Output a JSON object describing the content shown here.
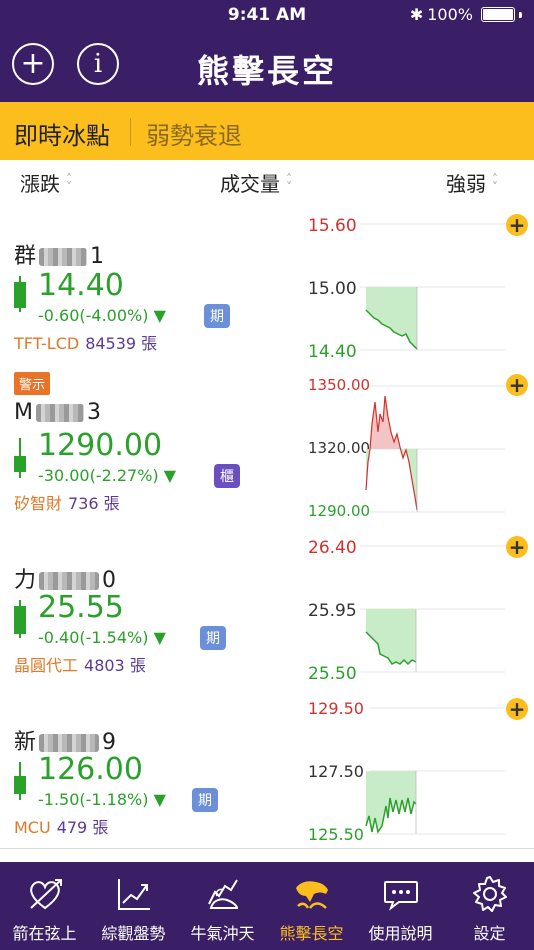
{
  "status": {
    "time": "9:41 AM",
    "battery": "100%",
    "bluetooth_icon": "bluetooth-icon"
  },
  "nav": {
    "title": "熊擊長空",
    "add_icon": "plus-circle-icon",
    "info_icon": "info-circle-icon",
    "add_symbol": "+",
    "info_symbol": "i"
  },
  "tabs": {
    "active": "即時冰點",
    "inactive": "弱勢衰退"
  },
  "columns": {
    "change": "漲跌",
    "volume": "成交量",
    "strength": "強弱"
  },
  "stocks": [
    {
      "name_prefix": "群",
      "name_suffix": "1",
      "price": "14.40",
      "change": "-0.60(-4.00%) ▼",
      "badge": "期",
      "industry": "TFT-LCD",
      "volume": "84539 張",
      "chart": {
        "high": "15.60",
        "mid": "15.00",
        "low": "14.40"
      }
    },
    {
      "warning": "警示",
      "name_prefix": "M",
      "name_suffix": "3",
      "price": "1290.00",
      "change": "-30.00(-2.27%) ▼",
      "badge": "櫃",
      "industry": "矽智財",
      "volume": "736 張",
      "chart": {
        "high": "1350.00",
        "mid": "1320.00",
        "low": "1290.00"
      }
    },
    {
      "name_prefix": "力",
      "name_suffix": "0",
      "price": "25.55",
      "change": "-0.40(-1.54%) ▼",
      "badge": "期",
      "industry": "晶圓代工",
      "volume": "4803 張",
      "chart": {
        "high": "26.40",
        "mid": "25.95",
        "low": "25.50"
      }
    },
    {
      "name_prefix": "新",
      "name_suffix": "9",
      "price": "126.00",
      "change": "-1.50(-1.18%) ▼",
      "badge": "期",
      "industry": "MCU",
      "volume": "479 張",
      "chart": {
        "high": "129.50",
        "mid": "127.50",
        "low": "125.50"
      }
    }
  ],
  "bottom_tabs": [
    {
      "label": "箭在弦上",
      "icon": "heart-arrow-icon"
    },
    {
      "label": "綜觀盤勢",
      "icon": "trend-chart-icon"
    },
    {
      "label": "牛氣沖天",
      "icon": "bull-icon"
    },
    {
      "label": "熊擊長空",
      "icon": "bear-icon",
      "active": true
    },
    {
      "label": "使用說明",
      "icon": "chat-bubble-icon"
    },
    {
      "label": "設定",
      "icon": "gear-icon"
    }
  ],
  "colors": {
    "brand": "#3b1f66",
    "accent": "#fbbe1c",
    "down": "#2aa12a",
    "up": "#d0312d"
  }
}
